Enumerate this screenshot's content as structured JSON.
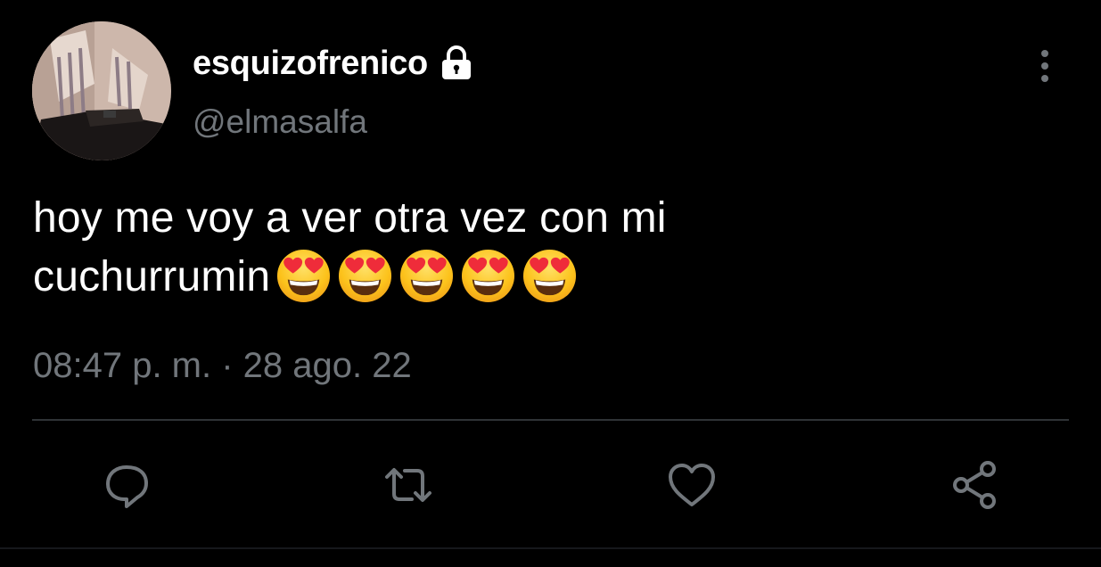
{
  "tweet": {
    "display_name": "esquizofrenico",
    "handle": "@elmasalfa",
    "protected": true,
    "text_line1": "hoy me voy a ver otra vez con mi",
    "text_line2": "cuchurrumin",
    "emojis": [
      "smiling-face-with-heart-eyes",
      "smiling-face-with-heart-eyes",
      "smiling-face-with-heart-eyes",
      "smiling-face-with-heart-eyes",
      "smiling-face-with-heart-eyes"
    ],
    "timestamp": "08:47 p. m. · 28 ago. 22"
  },
  "icons": {
    "lock": "lock-icon",
    "more": "more-vertical-icon",
    "reply": "reply-icon",
    "retweet": "retweet-icon",
    "like": "heart-icon",
    "share": "share-icon"
  },
  "colors": {
    "background": "#000000",
    "primary_text": "#ffffff",
    "secondary_text": "#71767b",
    "divider": "#2f3336",
    "icon": "#71767b"
  }
}
